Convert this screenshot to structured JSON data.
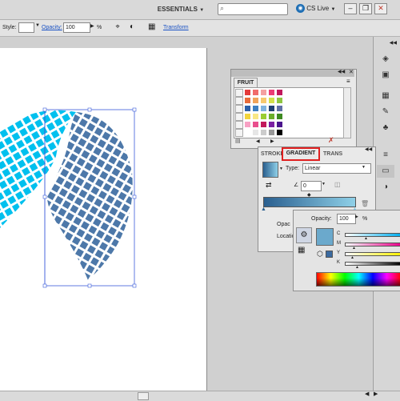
{
  "app_bar": {
    "workspace_label": "ESSENTIALS",
    "dropdown_glyph": "▼",
    "cs_live_label": "CS Live",
    "minimize": "–",
    "restore": "❐",
    "close": "✕"
  },
  "control_bar": {
    "style_label": "Style:",
    "opacity_label": "Opacity:",
    "opacity_value": "100",
    "percent": "%",
    "transform_label": "Transform"
  },
  "swatch_panel": {
    "title": "FRUIT",
    "colors": [
      [
        "#e43b3b",
        "#f06b6b",
        "#f4a0a0",
        "#ec3d74",
        "#c1185b"
      ],
      [
        "#e86b3a",
        "#f0a35a",
        "#f7c86e",
        "#d4e04a",
        "#8ec641"
      ],
      [
        "#2b5ea8",
        "#3d7fc1",
        "#7fb2de",
        "#1f3f73",
        "#5f6fa6"
      ],
      [
        "#f2d43d",
        "#f7e785",
        "#9acd32",
        "#6aae2a",
        "#3e8a22"
      ],
      [
        "#f7a1c4",
        "#e94f8e",
        "#c2185b",
        "#7b1fa2",
        "#4a148c"
      ],
      [
        "#ffffff",
        "#e6e6e6",
        "#cccccc",
        "#999999",
        "#000000"
      ]
    ]
  },
  "gradient_panel": {
    "tab_stroke": "STROKE",
    "tab_gradient": "GRADIENT",
    "tab_transparency": "TRANS",
    "type_label": "Type:",
    "type_value": "Linear",
    "angle_value": "0",
    "opacity_label": "Opac",
    "location_label": "Locatio",
    "gradient_start": "#2a5f8f",
    "gradient_end": "#8fd0e8"
  },
  "color_panel": {
    "opacity_label": "Opacity:",
    "opacity_value": "100",
    "percent": "%",
    "channels": [
      "C",
      "M",
      "Y",
      "K"
    ],
    "swatch_color": "#6ba9cc"
  },
  "accent_colors": {
    "selection": "#3a5bd9",
    "cyan_shape": "#00c0ee",
    "blue_shape": "#3a6aa0",
    "highlight": "#e02020"
  }
}
